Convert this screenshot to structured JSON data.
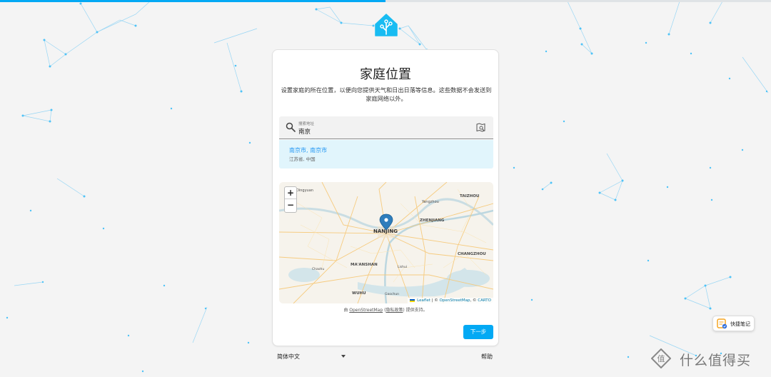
{
  "progress": {
    "fraction": 0.5
  },
  "colors": {
    "accent": "#03a9f4",
    "background": "#f4f4f4"
  },
  "logo": {
    "icon": "home-assistant-icon"
  },
  "card": {
    "title": "家庭位置",
    "description": "设置家庭的所在位置，以便向您提供天气和日出日落等信息。这些数据不会发送到家庭网络以外。"
  },
  "search": {
    "label": "搜索地址",
    "value": "南京",
    "icon": "search-icon",
    "map_pick_icon": "map-search-icon"
  },
  "result": {
    "title": "南京市, 南京市",
    "subtitle": "江苏省, 中国"
  },
  "map": {
    "zoom_in": "+",
    "zoom_out": "−",
    "places": [
      {
        "label": "Dingyuan",
        "size": "s"
      },
      {
        "label": "TAIZHOU",
        "size": "m"
      },
      {
        "label": "Yangzhou",
        "size": "s"
      },
      {
        "label": "ZHENJIANG",
        "size": "m"
      },
      {
        "label": "NANJING",
        "size": "l"
      },
      {
        "label": "CHANGZHOU",
        "size": "m"
      },
      {
        "label": "MA'ANSHAN",
        "size": "m"
      },
      {
        "label": "Chaohu",
        "size": "s"
      },
      {
        "label": "Lishui",
        "size": "s"
      },
      {
        "label": "WUHU",
        "size": "m"
      },
      {
        "label": "Gaochun",
        "size": "s"
      }
    ],
    "attribution": {
      "leaflet": "Leaflet",
      "sep1": " | © ",
      "osm": "OpenStreetMap",
      "sep2": ", © ",
      "carto": "CARTO"
    },
    "credit": {
      "prefix": "由 ",
      "osm": "OpenStreetMap",
      "mid": " (",
      "privacy": "隐私政策",
      "suffix": ") 提供支持。"
    }
  },
  "buttons": {
    "next": "下一步"
  },
  "footer": {
    "language": "简体中文",
    "help": "帮助"
  },
  "quick_note": {
    "label": "快捷笔记",
    "icon": "note-icon"
  },
  "watermark": {
    "text": "什么值得买",
    "badge": "值"
  }
}
